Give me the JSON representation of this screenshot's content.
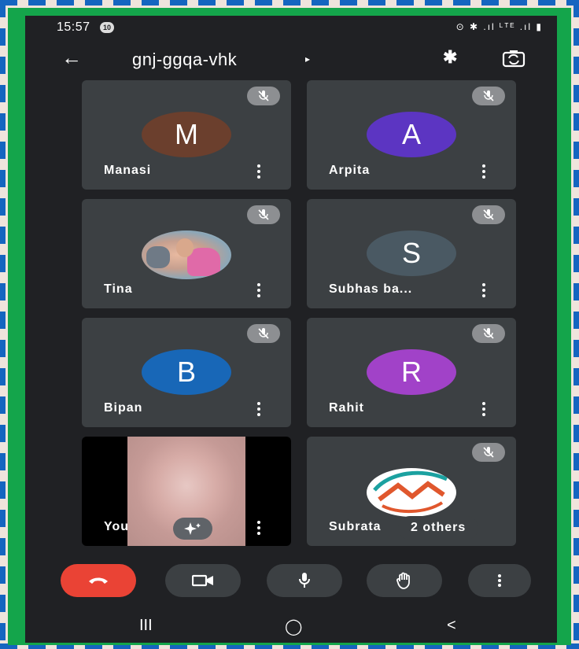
{
  "status_bar": {
    "time": "15:57",
    "notification_badge": "10",
    "right_icons": "⊙ ✱ .ıl ᴸᵀᴱ .ıl ▮"
  },
  "header": {
    "back_icon": "arrow-left-icon",
    "meeting_code": "gnj-ggqa-vhk",
    "caret": "▸",
    "bluetooth": "✱"
  },
  "participants": [
    {
      "name": "Manasi",
      "initial": "M",
      "color": "#6b3f2d",
      "muted": true
    },
    {
      "name": "Arpita",
      "initial": "A",
      "color": "#5c35c2",
      "muted": true
    },
    {
      "name": "Tina",
      "initial": "",
      "color": "#d5b9a6",
      "muted": true,
      "avatar": "photo"
    },
    {
      "name": "Subhas ba...",
      "initial": "S",
      "color": "#4a5963",
      "muted": true
    },
    {
      "name": "Bipan",
      "initial": "B",
      "color": "#1867b7",
      "muted": true
    },
    {
      "name": "Rahit",
      "initial": "R",
      "color": "#a142c8",
      "muted": true
    }
  ],
  "self_tile": {
    "name": "You"
  },
  "group_tile": {
    "name": "Subrata",
    "others_label": "2 others"
  },
  "controls": [
    "end-call",
    "camera",
    "microphone",
    "raise-hand",
    "more-options"
  ],
  "nav": {
    "recents": "III",
    "home": "◯",
    "back": "<"
  },
  "colors": {
    "frame": "#14a54b",
    "screen": "#202124",
    "tile": "#3c4043",
    "hangup": "#ea4335"
  }
}
